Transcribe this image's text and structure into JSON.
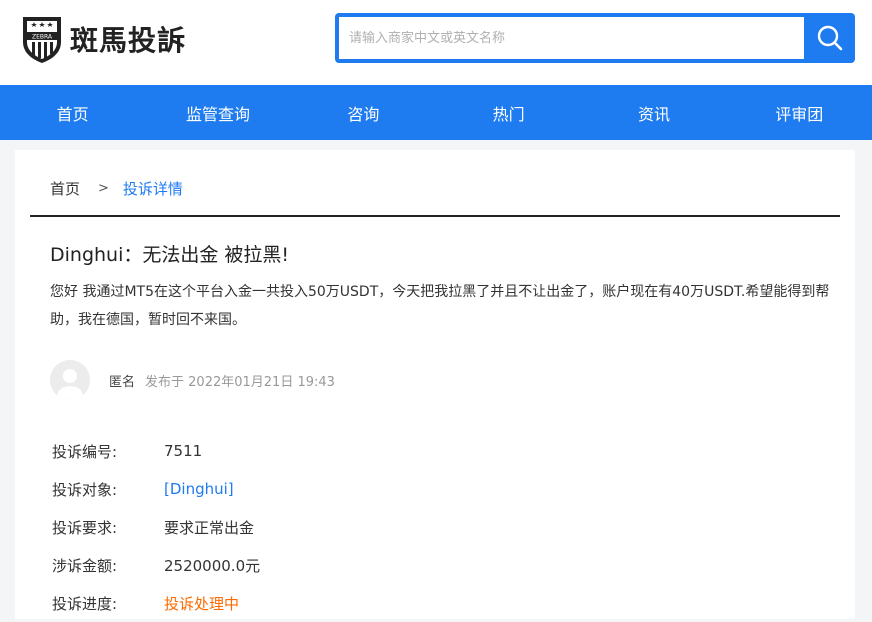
{
  "header": {
    "logo_text": "斑馬投訴",
    "logo_badge": "ZEBRA",
    "search": {
      "placeholder": "请输入商家中文或英文名称"
    }
  },
  "nav": {
    "items": [
      "首页",
      "监管查询",
      "咨询",
      "热门",
      "资讯",
      "评审团"
    ]
  },
  "breadcrumb": {
    "home": "首页",
    "separator": ">",
    "current": "投诉详情"
  },
  "complaint": {
    "title": "Dinghui：无法出金 被拉黑!",
    "description": "您好 我通过MT5在这个平台入金一共投入50万USDT，今天把我拉黑了并且不让出金了，账户现在有40万USDT.希望能得到帮助，我在德国，暂时回不来国。",
    "author": "匿名",
    "published": "发布于 2022年01月21日 19:43",
    "fields": [
      {
        "label": "投诉编号:",
        "value": "7511",
        "style": "normal"
      },
      {
        "label": "投诉对象:",
        "value": "[Dinghui]",
        "style": "link"
      },
      {
        "label": "投诉要求:",
        "value": "要求正常出金",
        "style": "normal"
      },
      {
        "label": "涉诉金额:",
        "value": "2520000.0元",
        "style": "normal"
      },
      {
        "label": "投诉进度:",
        "value": "投诉处理中",
        "style": "orange"
      }
    ]
  },
  "colors": {
    "brand_blue": "#1e7bf0",
    "status_orange": "#ff6a00"
  }
}
